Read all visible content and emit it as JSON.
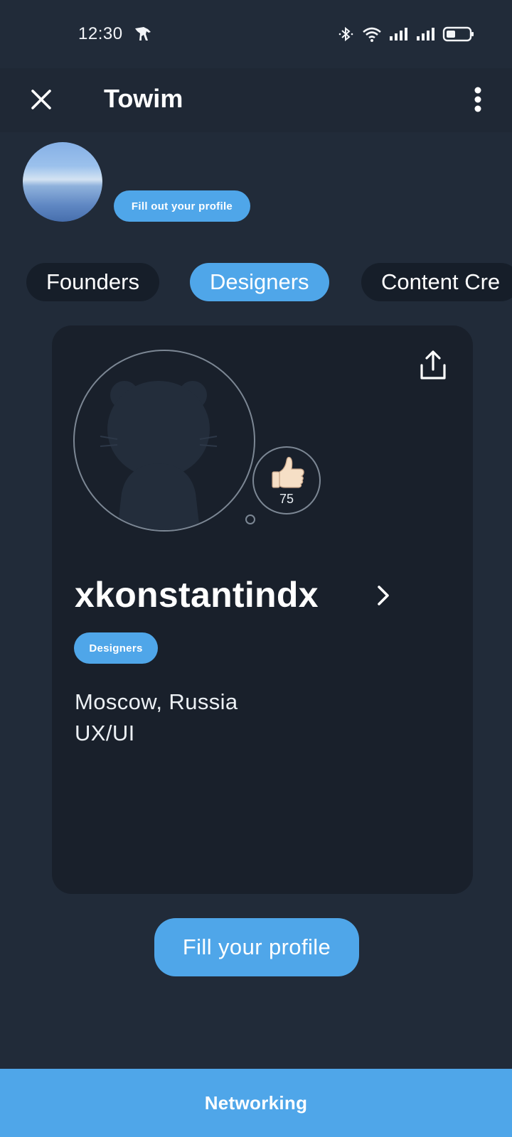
{
  "status_bar": {
    "time": "12:30",
    "icons": [
      "app-notification-icon",
      "bluetooth-icon",
      "wifi-icon",
      "signal-icon",
      "signal-icon",
      "battery-icon"
    ]
  },
  "app_bar": {
    "title": "Towim",
    "close_icon": "close-icon",
    "menu_icon": "more-vertical-icon"
  },
  "profile_header": {
    "fill_out_label": "Fill out your profile"
  },
  "tabs": [
    {
      "label": "Founders",
      "active": false
    },
    {
      "label": "Designers",
      "active": true
    },
    {
      "label": "Content Cre",
      "active": false
    }
  ],
  "card": {
    "share_icon": "share-icon",
    "likes": "75",
    "like_icon": "thumbs-up-icon",
    "username": "xkonstantindx",
    "role": "Designers",
    "location": "Moscow, Russia",
    "profession": "UX/UI"
  },
  "fill_profile_button": "Fill your profile",
  "bottom_nav": {
    "label": "Networking"
  },
  "colors": {
    "background": "#212b39",
    "app_bar": "#1f2835",
    "card": "#19202b",
    "accent": "#4fa6e9",
    "tab_inactive": "#161e29"
  }
}
